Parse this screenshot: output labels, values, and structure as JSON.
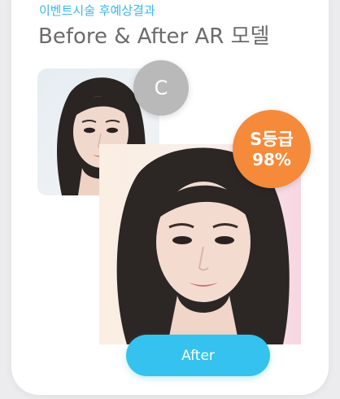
{
  "header": {
    "subtitle": "이벤트시술 후예상결과",
    "title": "Before & After AR 모델"
  },
  "before": {
    "grade": "C",
    "grade_color": "#b9b9b9"
  },
  "after": {
    "grade_line1": "S등급",
    "grade_line2": "98%",
    "grade_color": "#f58a3b",
    "button_label": "After",
    "button_color": "#35c2ef"
  },
  "colors": {
    "subtitle": "#3ab8ea",
    "title": "#6b6b6b"
  }
}
